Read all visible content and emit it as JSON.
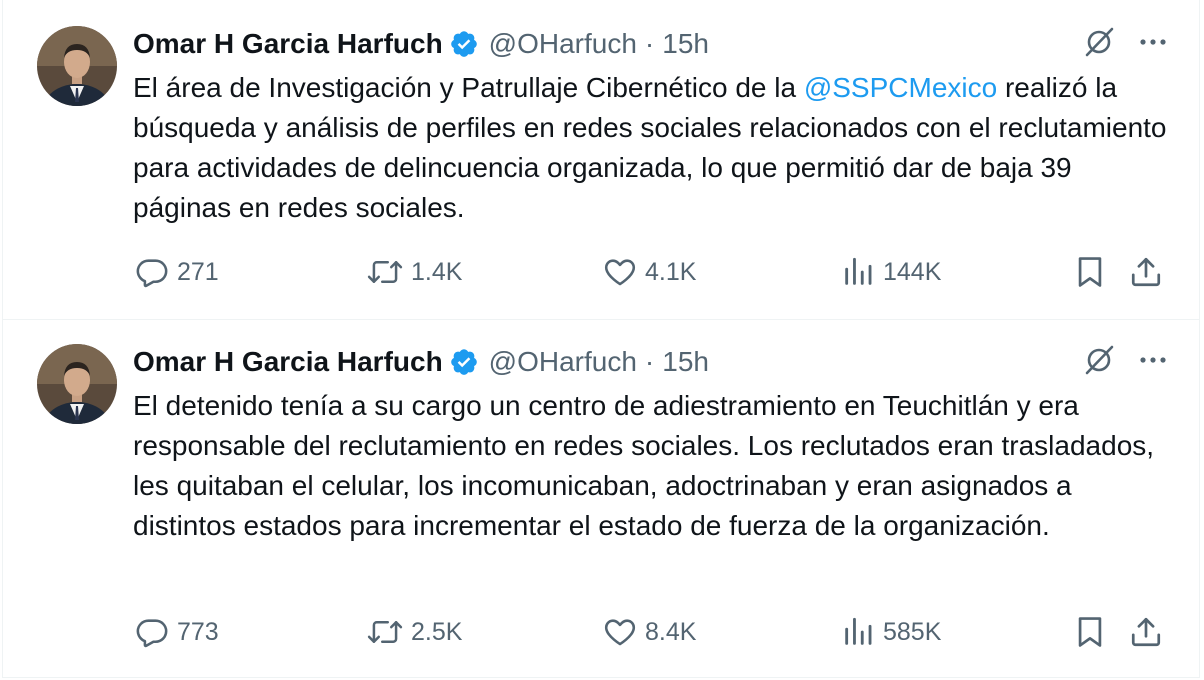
{
  "tweets": [
    {
      "author": {
        "name": "Omar H Garcia Harfuch",
        "handle": "@OHarfuch",
        "separator": "·",
        "time": "15h",
        "verified": true
      },
      "text": {
        "before_mention": "El área de Investigación y Patrullaje Cibernético de la ",
        "mention": "@SSPCMexico",
        "after_mention": " realizó la búsqueda y análisis de perfiles en redes sociales relacionados con el reclutamiento para actividades de delincuencia organizada, lo que permitió dar de baja 39 páginas en redes sociales."
      },
      "stats": {
        "replies": "271",
        "reposts": "1.4K",
        "likes": "4.1K",
        "views": "144K"
      }
    },
    {
      "author": {
        "name": "Omar H Garcia Harfuch",
        "handle": "@OHarfuch",
        "separator": "·",
        "time": "15h",
        "verified": true
      },
      "text": {
        "full": "El detenido tenía a su cargo un centro de adiestramiento en Teuchitlán y era responsable del reclutamiento en redes sociales. Los reclutados eran trasladados, les quitaban el celular, los incomunicaban, adoctrinaban y eran asignados a distintos estados para incrementar el estado de fuerza de la organización."
      },
      "stats": {
        "replies": "773",
        "reposts": "2.5K",
        "likes": "8.4K",
        "views": "585K"
      }
    }
  ],
  "icons": {
    "top": [
      "grok-icon",
      "more-icon"
    ],
    "actions": [
      "reply-icon",
      "repost-icon",
      "like-icon",
      "views-icon",
      "bookmark-icon",
      "share-icon"
    ]
  },
  "colors": {
    "text": "#0f1419",
    "secondary": "#536471",
    "accent": "#1d9bf0",
    "border": "#eff3f4"
  }
}
